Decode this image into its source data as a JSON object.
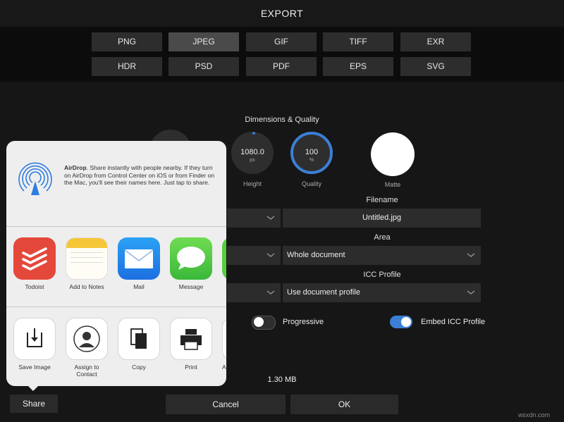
{
  "title": "EXPORT",
  "formats": [
    "PNG",
    "JPEG",
    "GIF",
    "TIFF",
    "EXR",
    "HDR",
    "PSD",
    "PDF",
    "EPS",
    "SVG"
  ],
  "selected_format": "JPEG",
  "dimensions": {
    "heading": "Dimensions & Quality",
    "height_value": "1080.0",
    "height_unit": "px",
    "height_label": "Height",
    "quality_value": "100",
    "quality_unit": "%",
    "quality_label": "Quality",
    "matte_label": "Matte",
    "matte_color": "#ffffff"
  },
  "filename": {
    "label": "Filename",
    "value": "Untitled.jpg"
  },
  "area": {
    "label": "Area",
    "value": "Whole document"
  },
  "icc": {
    "label": "ICC Profile",
    "value": "Use document profile"
  },
  "progressive": {
    "label": "Progressive",
    "on": false
  },
  "embed_icc": {
    "label": "Embed ICC Profile",
    "on": true
  },
  "file_size": "1.30 MB",
  "buttons": {
    "cancel": "Cancel",
    "ok": "OK",
    "share": "Share"
  },
  "accent_color": "#3b7fd6",
  "share_sheet": {
    "airdrop_title": "AirDrop",
    "airdrop_text": ". Share instantly with people nearby. If they turn on AirDrop from Control Center on iOS or from Finder on the Mac, you'll see their names here. Just tap to share.",
    "apps": [
      {
        "label": "Todoist",
        "icon": "todoist-icon"
      },
      {
        "label": "Add to Notes",
        "icon": "notes-icon"
      },
      {
        "label": "Mail",
        "icon": "mail-icon"
      },
      {
        "label": "Message",
        "icon": "message-icon"
      }
    ],
    "actions": [
      {
        "label": "Save Image",
        "icon": "save-image-icon"
      },
      {
        "label": "Assign to Contact",
        "icon": "contact-icon"
      },
      {
        "label": "Copy",
        "icon": "copy-icon"
      },
      {
        "label": "Print",
        "icon": "print-icon"
      },
      {
        "label": "Ad",
        "icon": "partial-action-icon"
      }
    ]
  },
  "watermark": "wsxdn.com"
}
